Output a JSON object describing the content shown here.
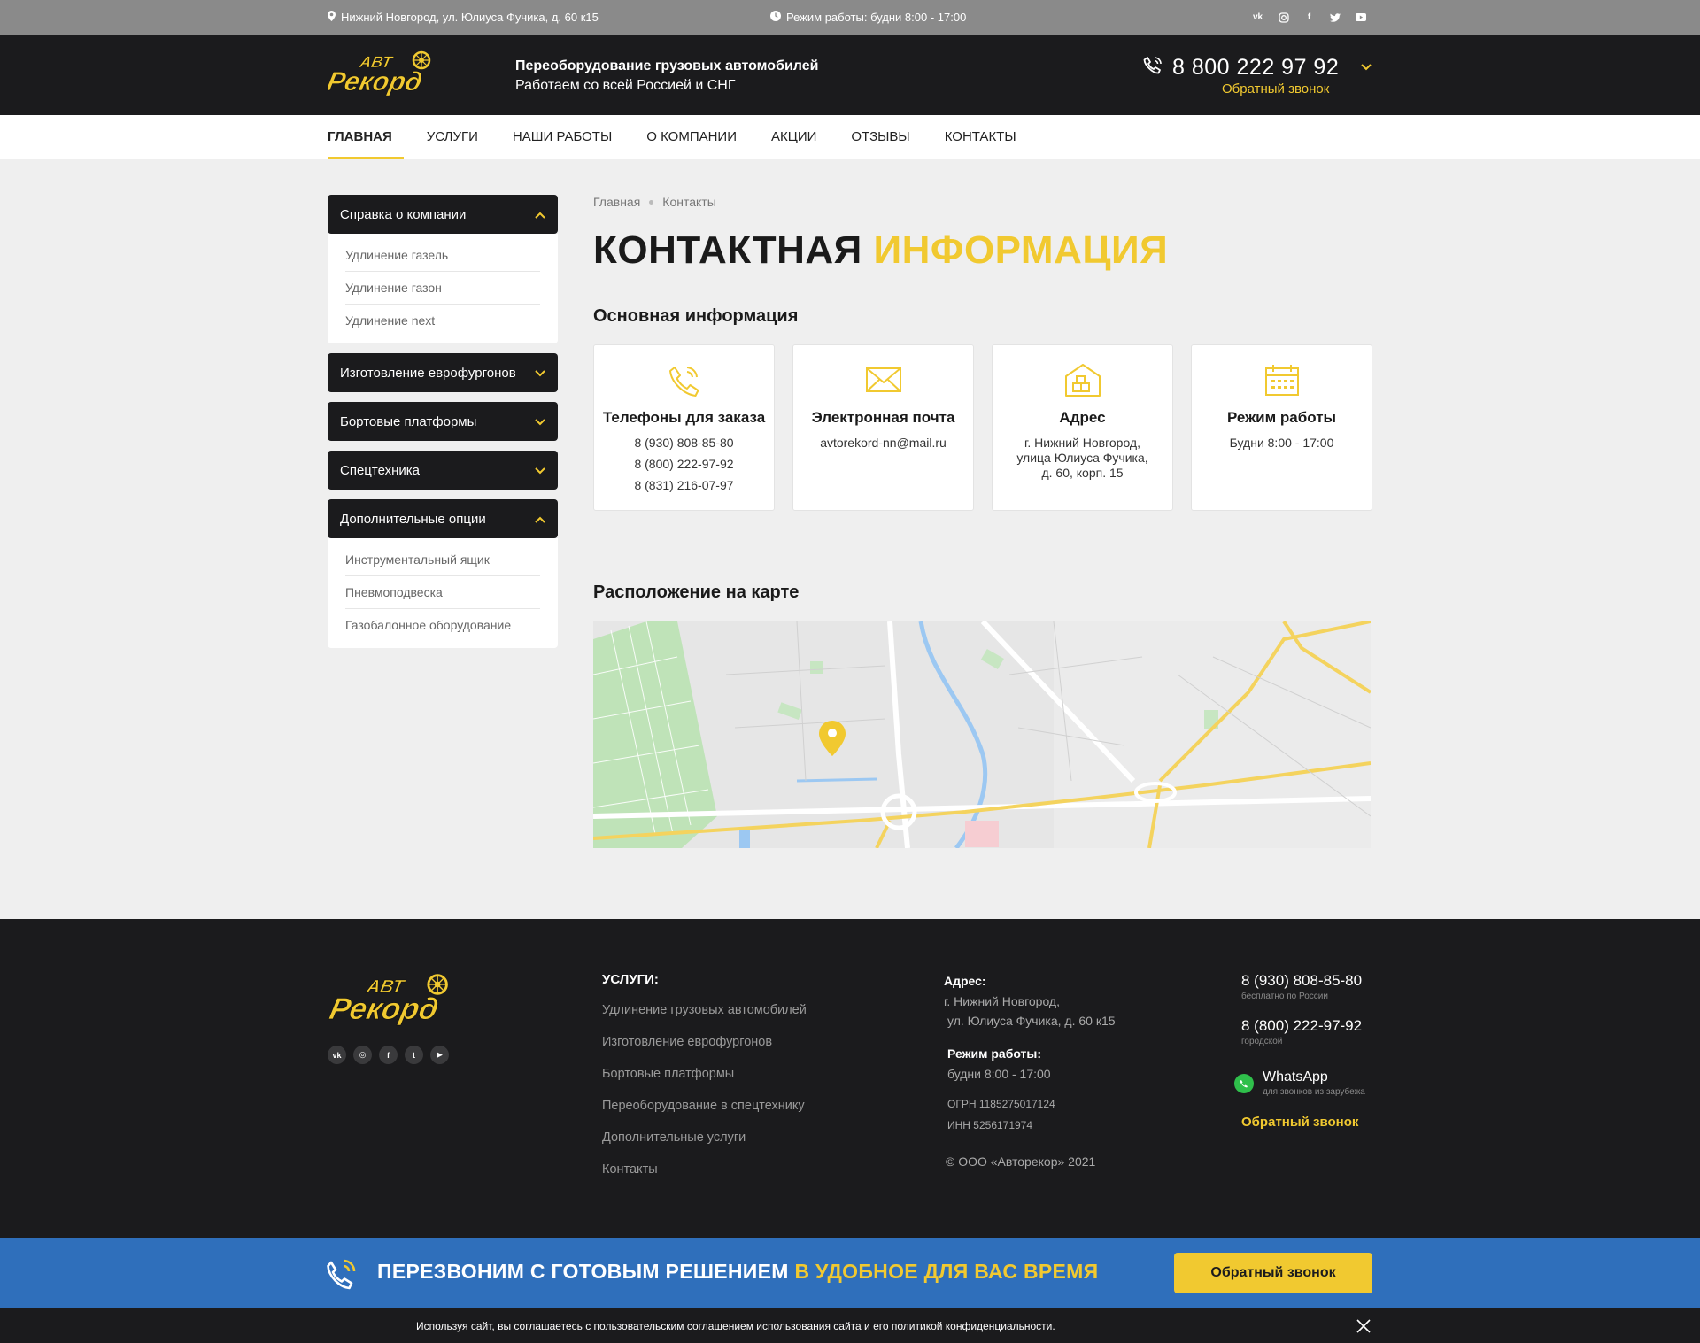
{
  "topbar": {
    "address": "Нижний Новгород, ул. Юлиуса Фучика, д. 60 к15",
    "hours": "Режим работы: будни 8:00 - 17:00",
    "socials": [
      "vk",
      "instagram",
      "facebook",
      "twitter",
      "youtube"
    ]
  },
  "header": {
    "logo_text": "АвтоРекорд",
    "tagline_1": "Переоборудование грузовых автомобилей",
    "tagline_2": "Работаем со всей Россией и СНГ",
    "phone": "8 800 222 97 92",
    "callback": "Обратный звонок"
  },
  "nav": [
    {
      "label": "Главная",
      "active": true
    },
    {
      "label": "Услуги"
    },
    {
      "label": "Наши работы"
    },
    {
      "label": "О компании"
    },
    {
      "label": "Акции"
    },
    {
      "label": "Отзывы"
    },
    {
      "label": "Контакты"
    }
  ],
  "sidebar": [
    {
      "title": "Справка о компании",
      "open": true,
      "items": [
        "Удлинение газель",
        "Удлинение газон",
        "Удлинение next"
      ]
    },
    {
      "title": "Изготовление еврофургонов",
      "open": false
    },
    {
      "title": "Бортовые платформы",
      "open": false
    },
    {
      "title": "Спецтехника",
      "open": false
    },
    {
      "title": "Дополнительные опции",
      "open": true,
      "items": [
        "Инструментальный ящик",
        "Пневмоподвеска",
        "Газобалонное оборудование"
      ]
    }
  ],
  "breadcrumbs": {
    "home": "Главная",
    "current": "Контакты"
  },
  "page_title": {
    "part1": "КОНТАКТНАЯ",
    "part2": "ИНФОРМАЦИЯ"
  },
  "main_info_heading": "Основная информация",
  "cards": [
    {
      "icon": "phone-icon",
      "title": "Телефоны для заказа",
      "lines": [
        "8 (930) 808-85-80",
        "8 (800) 222-97-92",
        "8 (831) 216-07-97"
      ]
    },
    {
      "icon": "mail-icon",
      "title": "Электронная почта",
      "lines": [
        "avtorekord-nn@mail.ru"
      ]
    },
    {
      "icon": "warehouse-icon",
      "title": "Адрес",
      "lines": [
        "г. Нижний Новгород,",
        "улица Юлиуса Фучика,",
        "д. 60, корп. 15"
      ]
    },
    {
      "icon": "calendar-icon",
      "title": "Режим работы",
      "lines": [
        "Будни  8:00 - 17:00"
      ]
    }
  ],
  "map_heading": "Расположение на карте",
  "footer": {
    "services_label": "УСЛУГИ:",
    "services": [
      "Удлинение грузовых автомобилей",
      "Изготовление еврофургонов",
      "Бортовые платформы",
      "Переоборудование в спецтехнику",
      "Дополнительные услуги",
      "Контакты"
    ],
    "address_label": "Адрес:",
    "address_1": "г. Нижний Новгород,",
    "address_2": "ул. Юлиуса Фучика, д. 60 к15",
    "hours_label": "Режим работы:",
    "hours": "будни  8:00 - 17:00",
    "ogrn": "ОГРН 1185275017124",
    "inn": "ИНН 5256171974",
    "copyright": "© ООО «Авторекор» 2021",
    "phone1": "8 (930) 808-85-80",
    "phone1_note": "бесплатно по России",
    "phone2": "8 (800) 222-97-92",
    "phone2_note": "городской",
    "whatsapp": "WhatsApp",
    "whatsapp_note": "для звонков из зарубежа",
    "callback": "Обратный звонок"
  },
  "cta": {
    "text_1": "ПЕРЕЗВОНИМ С ГОТОВЫМ РЕШЕНИЕМ",
    "text_2": "В УДОБНОЕ ДЛЯ ВАС ВРЕМЯ",
    "button": "Обратный звонок"
  },
  "cookie": {
    "t1": "Используя  сайт, вы соглашаетесь с ",
    "link1": "пользовательским соглашением",
    "t2": "  использования сайта и его  ",
    "link2": "политикой конфиденциальности."
  },
  "colors": {
    "accent": "#f1c930",
    "dark": "#1b1b1d",
    "cta_blue": "#2f6fbb"
  }
}
